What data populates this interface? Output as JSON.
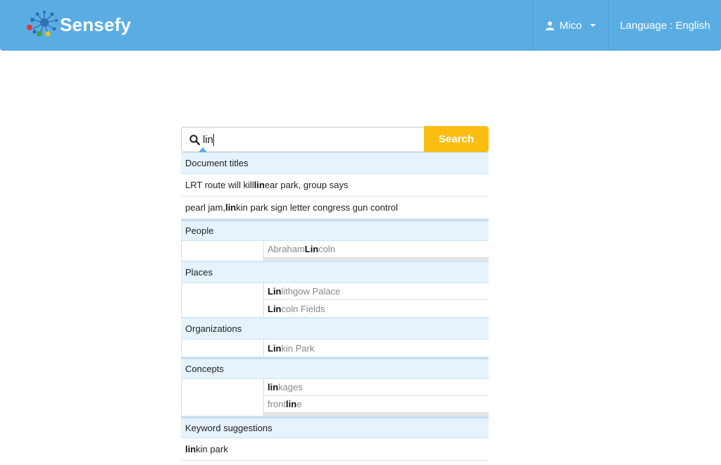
{
  "navbar": {
    "brand_name": "Sensefy",
    "user_name": "Mico",
    "language_label": "Language",
    "language_sep": ":",
    "language_value": "English",
    "bg_color": "#5aade3"
  },
  "search": {
    "query": "lin",
    "button_label": "Search",
    "button_color": "#fbbd12"
  },
  "dropdown": {
    "document_titles": {
      "heading": "Document titles",
      "items": [
        {
          "before": "LRT route will kill ",
          "match": "lin",
          "after": "ear park, group says"
        },
        {
          "before": "pearl jam, ",
          "match": "lin",
          "after": "kin park sign letter congress gun control"
        }
      ]
    },
    "people": {
      "heading": "People",
      "items": [
        {
          "before": "Abraham ",
          "match": "Lin",
          "after": "coln"
        }
      ]
    },
    "places": {
      "heading": "Places",
      "items": [
        {
          "before": "",
          "match": "Lin",
          "after": "lithgow Palace"
        },
        {
          "before": "",
          "match": "Lin",
          "after": "coln Fields"
        }
      ]
    },
    "organizations": {
      "heading": "Organizations",
      "items": [
        {
          "before": "",
          "match": "Lin",
          "after": "kin Park"
        }
      ]
    },
    "concepts": {
      "heading": "Concepts",
      "items": [
        {
          "before": "",
          "match": "lin",
          "after": "kages"
        },
        {
          "before": "front ",
          "match": "lin",
          "after": "e"
        }
      ]
    },
    "keyword_suggestions": {
      "heading": "Keyword suggestions",
      "items": [
        {
          "before": "",
          "match": "lin",
          "after": "kin park"
        }
      ]
    }
  }
}
